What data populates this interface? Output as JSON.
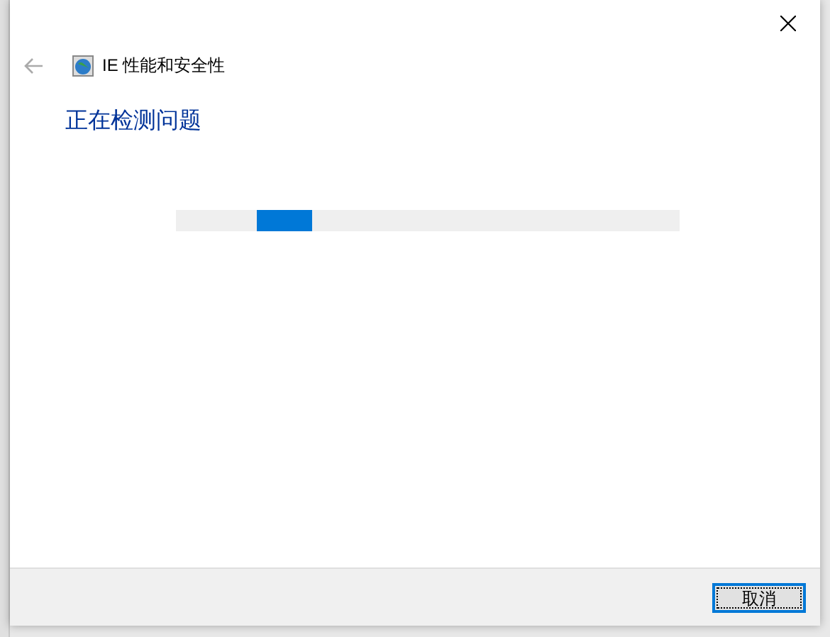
{
  "window": {
    "title": "IE 性能和安全性"
  },
  "heading": "正在检测问题",
  "progress": {
    "level": 0.16
  },
  "buttons": [
    {
      "label": "取消",
      "selected": true
    }
  ]
}
